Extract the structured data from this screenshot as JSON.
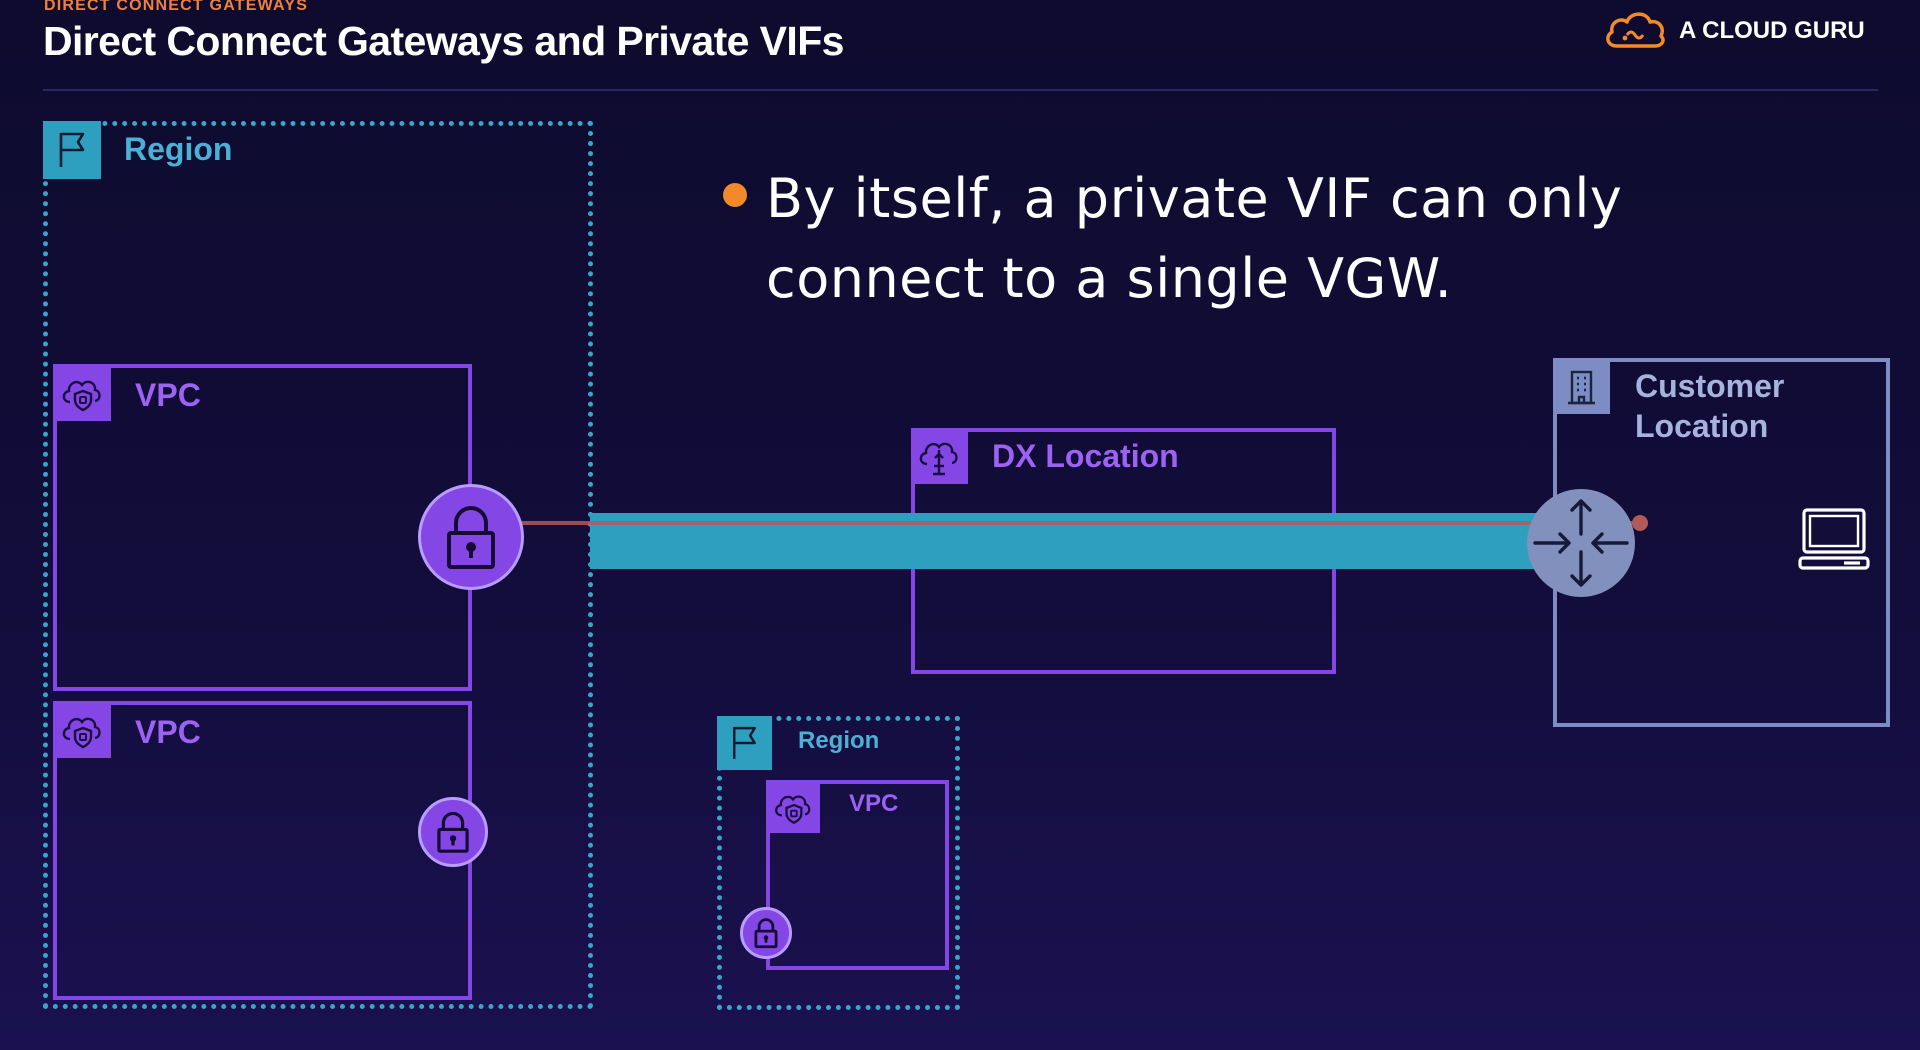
{
  "header": {
    "eyebrow": "DIRECT CONNECT GATEWAYS",
    "title": "Direct Connect Gateways and Private VIFs",
    "logo_text": "A CLOUD GURU",
    "logo_icon": "cloud-guru-logo-icon"
  },
  "bullet": {
    "text": "By itself, a private VIF can only connect to a single VGW."
  },
  "diagram": {
    "region_main": {
      "label": "Region",
      "icon": "region-flag-icon"
    },
    "vpc_1": {
      "label": "VPC",
      "icon": "vpc-cloud-shield-icon"
    },
    "vpc_2": {
      "label": "VPC",
      "icon": "vpc-cloud-shield-icon"
    },
    "region_small": {
      "label": "Region",
      "icon": "region-flag-icon"
    },
    "vpc_small": {
      "label": "VPC",
      "icon": "vpc-cloud-shield-icon"
    },
    "dx_location": {
      "label": "DX Location",
      "icon": "dx-location-cloud-icon"
    },
    "customer_location": {
      "label": "Customer Location",
      "icon": "building-icon"
    },
    "vgw_icon": "vgw-lock-icon",
    "router_icon": "router-arrows-icon",
    "computer_icon": "laptop-icon"
  },
  "colors": {
    "background": "#120d3a",
    "accent_orange": "#f28a2b",
    "region_blue": "#2f9fbf",
    "vpc_purple": "#8447e6",
    "customer_gray": "#7d8cc2",
    "vif_red": "#b25a5a"
  }
}
